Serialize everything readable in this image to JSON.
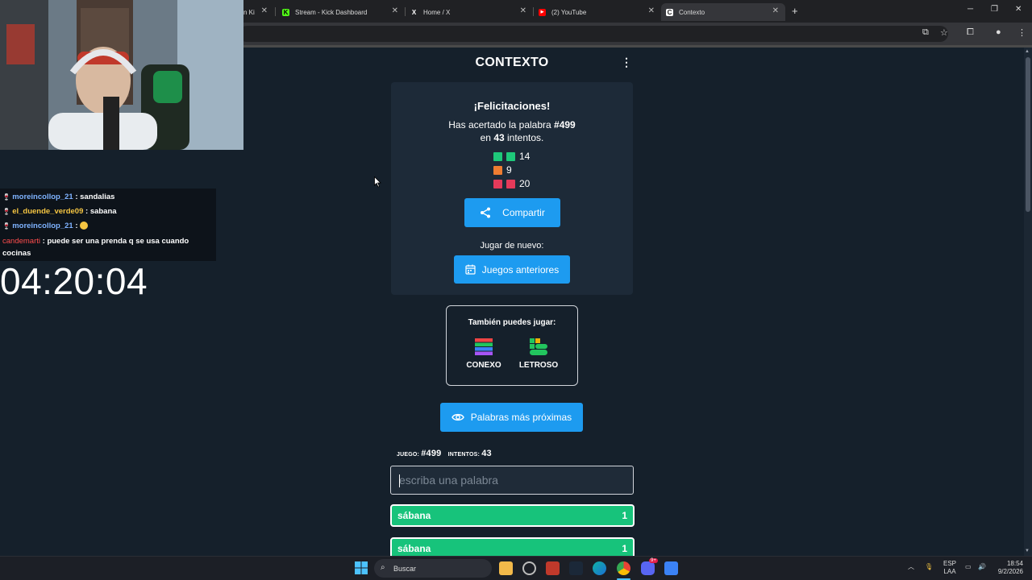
{
  "browser": {
    "tabs": [
      {
        "label": "n Ki",
        "icon": "kick-icon"
      },
      {
        "label": "Stream - Kick Dashboard",
        "icon": "kick-icon"
      },
      {
        "label": "Home / X",
        "icon": "x-icon"
      },
      {
        "label": "(2) YouTube",
        "icon": "youtube-icon"
      },
      {
        "label": "Contexto",
        "icon": "contexto-icon",
        "active": true
      }
    ],
    "new_tab": "+",
    "window_controls": {
      "minimize": "─",
      "maximize": "❐",
      "close": "✕"
    }
  },
  "site": {
    "title": "CONTEXTO",
    "menu_icon": "⋮"
  },
  "congrats": {
    "heading": "¡Felicitaciones!",
    "text_before_word": "Has acertado la palabra ",
    "word_number": "#499",
    "text_en": "en ",
    "attempts": "43",
    "text_attempts": " intentos.",
    "stats": [
      {
        "count": "14",
        "color": "#1ec87a",
        "squares": 2
      },
      {
        "count": "9",
        "color": "#ef7d31",
        "squares": 1
      },
      {
        "count": "20",
        "color": "#ef4444",
        "squares": 2
      }
    ],
    "share_label": "Compartir",
    "play_again_label": "Jugar de nuevo:",
    "previous_games_label": "Juegos anteriores"
  },
  "also_play": {
    "title": "También puedes jugar:",
    "games": [
      {
        "name": "CONEXO",
        "icon": "conexo-icon"
      },
      {
        "name": "LETROSO",
        "icon": "letroso-icon"
      }
    ]
  },
  "closest_words_label": "Palabras más próximas",
  "game_info": {
    "game_label": "JUEGO:",
    "game_value": "#499",
    "attempts_label": "INTENTOS:",
    "attempts_value": "43"
  },
  "input": {
    "placeholder": "escriba una palabra"
  },
  "guesses": [
    {
      "word": "sábana",
      "rank": "1"
    },
    {
      "word": "sábana",
      "rank": "1"
    }
  ],
  "overlay": {
    "chat": [
      {
        "user": "moreincollop_21",
        "message": " : sandalias",
        "color": "#7fb3ff"
      },
      {
        "user": "el_duende_verde09",
        "message": " : sabana",
        "color": "#f5c542"
      },
      {
        "user": "moreincollop_21",
        "message": " : ",
        "color": "#7fb3ff"
      },
      {
        "user": "candemarti",
        "message": " : puede ser una prenda q se usa cuando",
        "color": "#ff4d4d"
      },
      {
        "user": "",
        "message": "cocinas",
        "color": "#ffffff"
      }
    ],
    "timer": "04:20:04"
  },
  "taskbar": {
    "search_label": "Buscar",
    "lang_top": "ESP",
    "lang_bottom": "LAA",
    "time": "18:54",
    "date": "9/2/2026",
    "notif_badge": "9+"
  },
  "colors": {
    "page_bg": "#15202b",
    "card_bg": "#1d2a38",
    "accent": "#1d9bf0",
    "green": "#17c37b"
  }
}
